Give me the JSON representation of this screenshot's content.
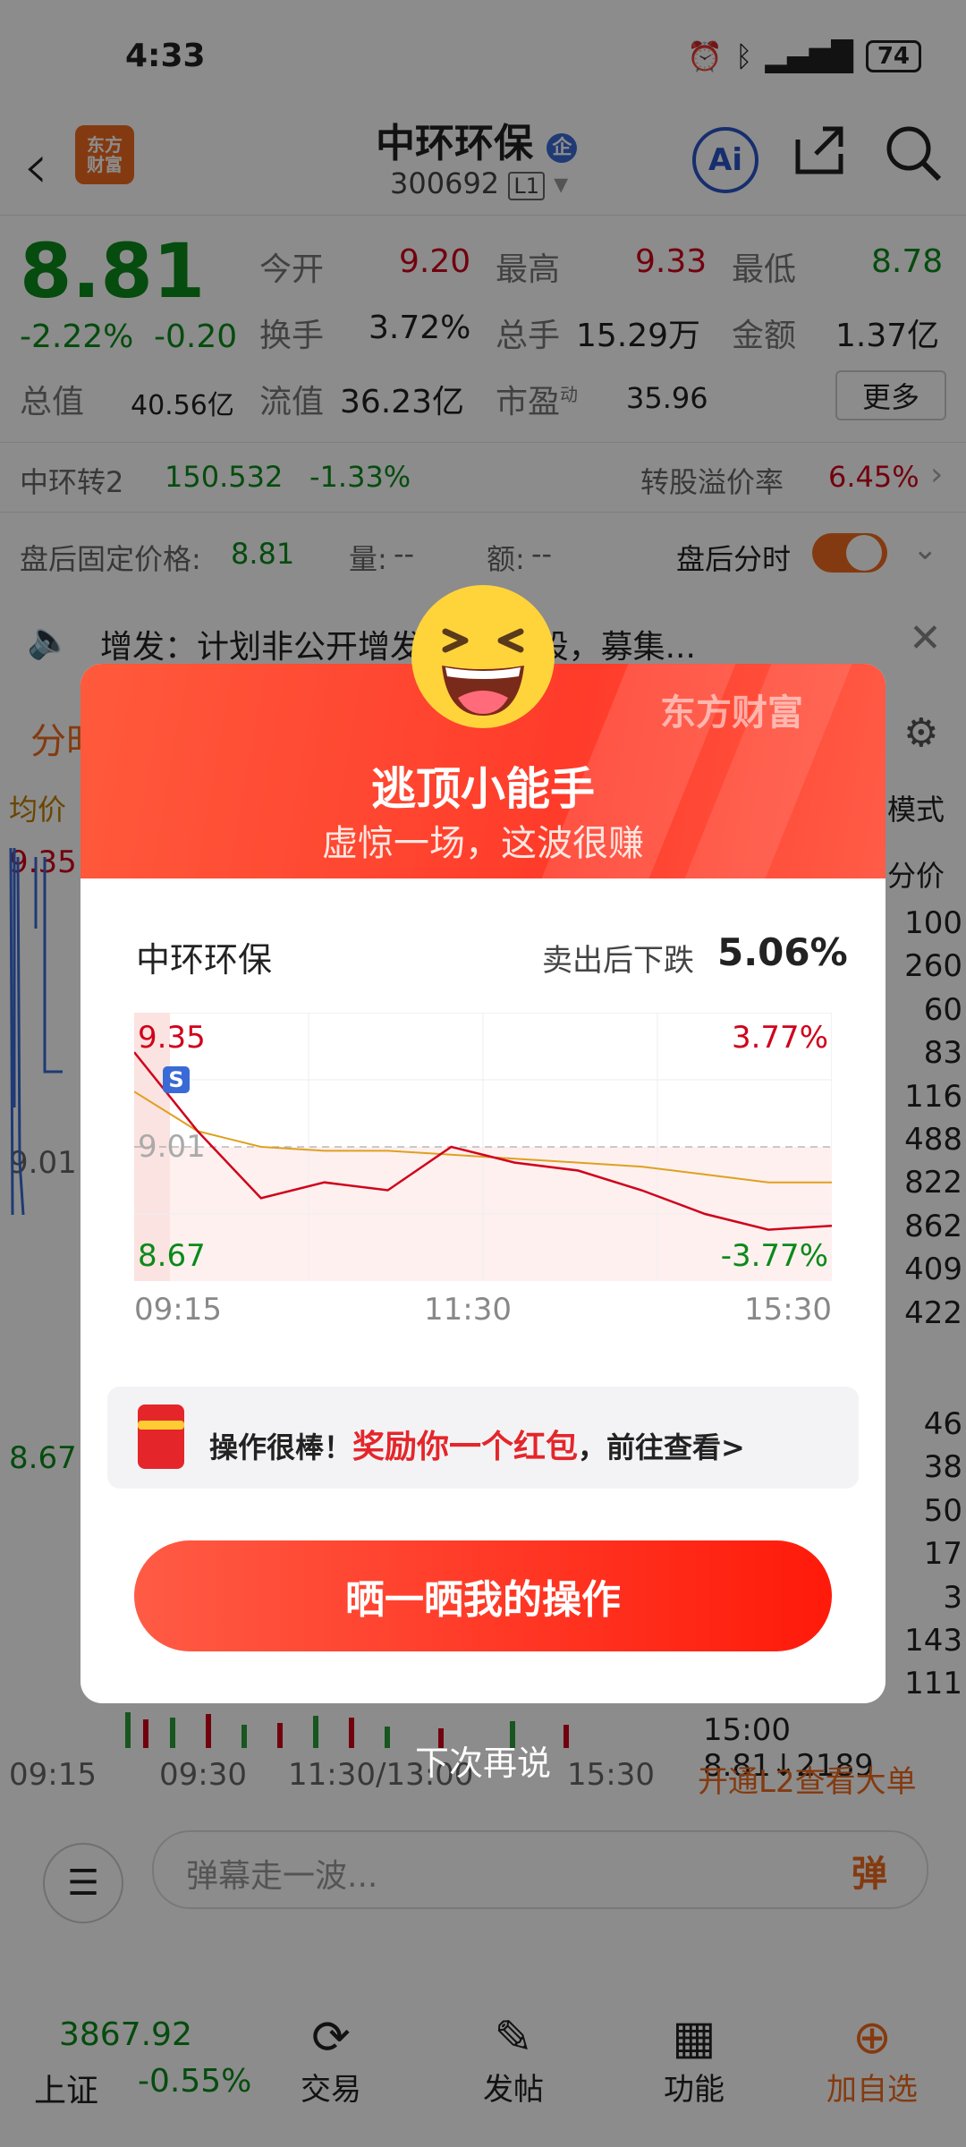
{
  "status": {
    "time": "4:33",
    "battery": "74"
  },
  "header": {
    "logo_text": "东方\n财富",
    "stock_name": "中环环保",
    "stock_badge": "企",
    "stock_code": "300692",
    "level_badge": "L1",
    "ai_label": "Ai"
  },
  "quote": {
    "price": "8.81",
    "change_pct": "-2.22%",
    "change": "-0.20",
    "open_label": "今开",
    "open": "9.20",
    "high_label": "最高",
    "high": "9.33",
    "low_label": "最低",
    "low": "8.78",
    "turnover_label": "换手",
    "turnover": "3.72%",
    "volume_label": "总手",
    "volume": "15.29万",
    "amount_label": "金额",
    "amount": "1.37亿",
    "mktcap_label": "总值",
    "mktcap": "40.56亿",
    "float_label": "流值",
    "float": "36.23亿",
    "pe_label": "市盈",
    "pe_sup": "动",
    "pe": "35.96",
    "more_label": "更多"
  },
  "convertible": {
    "name": "中环转2",
    "price": "150.532",
    "change": "-1.33%",
    "premium_label": "转股溢价率",
    "premium": "6.45%"
  },
  "afterhours": {
    "price_label": "盘后固定价格:",
    "price": "8.81",
    "vol_label": "量:",
    "vol": "--",
    "amt_label": "额:",
    "amt": "--",
    "timeshare_label": "盘后分时"
  },
  "notice": {
    "text": "增发：计划非公开增发4380万股，募集..."
  },
  "bg": {
    "tab": "分时",
    "avg_label": "均价",
    "mode_label": "模式",
    "price_col_label": "分价",
    "hi": "9.35",
    "mid": "9.01",
    "lo": "8.67",
    "right_nums": [
      "100",
      "260",
      "60",
      "83",
      "116",
      "488",
      "822",
      "862",
      "409",
      "422"
    ],
    "right_nums2": [
      "46",
      "38",
      "50",
      "17",
      "3",
      "143",
      "111"
    ],
    "last_trade": "15:00   8.81↓2189",
    "times": [
      "09:15",
      "09:30",
      "11:30/13:00",
      "15:30"
    ],
    "l2_banner": "开通L2查看大单",
    "danmaku_placeholder": "弹幕走一波...",
    "danmaku_btn": "弹"
  },
  "bottom_nav": {
    "index_value": "3867.92",
    "index_name": "上证",
    "index_change": "-0.55%",
    "items": [
      "交易",
      "发帖",
      "功能",
      "加自选"
    ]
  },
  "modal": {
    "brand": "东方财富",
    "title": "逃顶小能手",
    "subtitle": "虚惊一场，这波很赚",
    "stock": "中环环保",
    "drop_label": "卖出后下跌",
    "drop_value": "5.06%",
    "reward_prefix": "操作很棒！",
    "reward_highlight": "奖励你一个红包",
    "reward_suffix": "，前往查看>",
    "cta": "晒一晒我的操作",
    "later": "下次再说",
    "sell_marker": "S"
  },
  "chart_data": {
    "type": "line",
    "x": [
      "09:15",
      "09:30",
      "10:00",
      "10:30",
      "11:00",
      "11:30",
      "13:00",
      "13:30",
      "14:00",
      "14:30",
      "15:00",
      "15:30"
    ],
    "series": [
      {
        "values": [
          9.25,
          9.05,
          8.88,
          8.92,
          8.9,
          9.01,
          8.97,
          8.95,
          8.9,
          8.84,
          8.8,
          8.81
        ]
      },
      {
        "values": [
          9.15,
          9.05,
          9.01,
          9.0,
          9.0,
          8.99,
          8.98,
          8.97,
          8.96,
          8.94,
          8.92,
          8.92
        ]
      }
    ],
    "ylim": [
      8.67,
      9.35
    ],
    "ref": 9.01,
    "y_labels": {
      "top": "9.35",
      "mid": "9.01",
      "bottom": "8.67",
      "top_pct": "3.77%",
      "bottom_pct": "-3.77%"
    },
    "x_ticks": [
      "09:15",
      "11:30",
      "15:30"
    ],
    "colors": {
      "price": "#d0021b",
      "avg": "#e0a020"
    }
  }
}
